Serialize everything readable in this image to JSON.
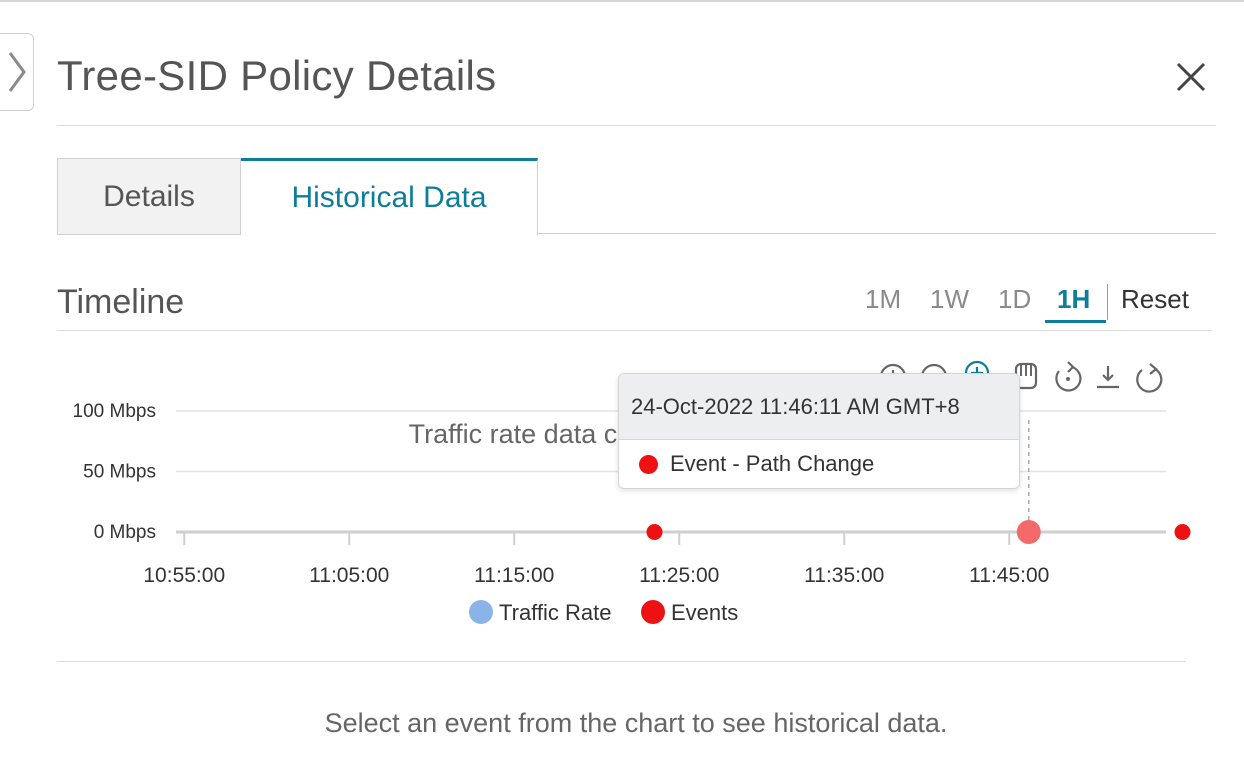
{
  "header": {
    "title": "Tree-SID Policy Details",
    "collapse_icon": "chevron-right-icon",
    "close_icon": "close-icon"
  },
  "tabs": [
    {
      "label": "Details",
      "active": false
    },
    {
      "label": "Historical Data",
      "active": true
    }
  ],
  "timeline": {
    "title": "Timeline",
    "ranges": [
      "1M",
      "1W",
      "1D",
      "1H"
    ],
    "active_range": "1H",
    "reset_label": "Reset"
  },
  "toolbar_icons": [
    "zoom-in-icon",
    "zoom-out-icon",
    "zoom-select-icon",
    "pan-hand-icon",
    "reset-zoom-icon",
    "download-icon",
    "refresh-icon"
  ],
  "chart_data": {
    "type": "scatter",
    "y_tick_labels": [
      "100 Mbps",
      "50 Mbps",
      "0 Mbps"
    ],
    "y_ticks": [
      100,
      50,
      0
    ],
    "ylim": [
      0,
      100
    ],
    "x_tick_labels": [
      "10:55:00",
      "11:05:00",
      "11:15:00",
      "11:25:00",
      "11:35:00",
      "11:45:00"
    ],
    "x_range": [
      "10:54:30",
      "11:54:30"
    ],
    "no_data_message": "Traffic rate data co                                              ed",
    "legend": [
      {
        "name": "Traffic Rate",
        "color": "#8ab4e8"
      },
      {
        "name": "Events",
        "color": "#ee1111"
      }
    ],
    "series": [
      {
        "name": "Traffic Rate",
        "values": []
      },
      {
        "name": "Events",
        "points": [
          {
            "time": "11:23:30",
            "value": 0
          },
          {
            "time": "11:46:11",
            "value": 0,
            "highlighted": true
          },
          {
            "time": "11:55:30",
            "value": 0
          }
        ]
      }
    ]
  },
  "tooltip": {
    "timestamp": "24-Oct-2022 11:46:11 AM GMT+8",
    "event_label": "Event - Path Change"
  },
  "footer": {
    "hint": "Select an event from the chart to see historical data."
  },
  "colors": {
    "accent": "#0d7d9a",
    "event": "#ee1111",
    "traffic": "#8ab4e8"
  }
}
